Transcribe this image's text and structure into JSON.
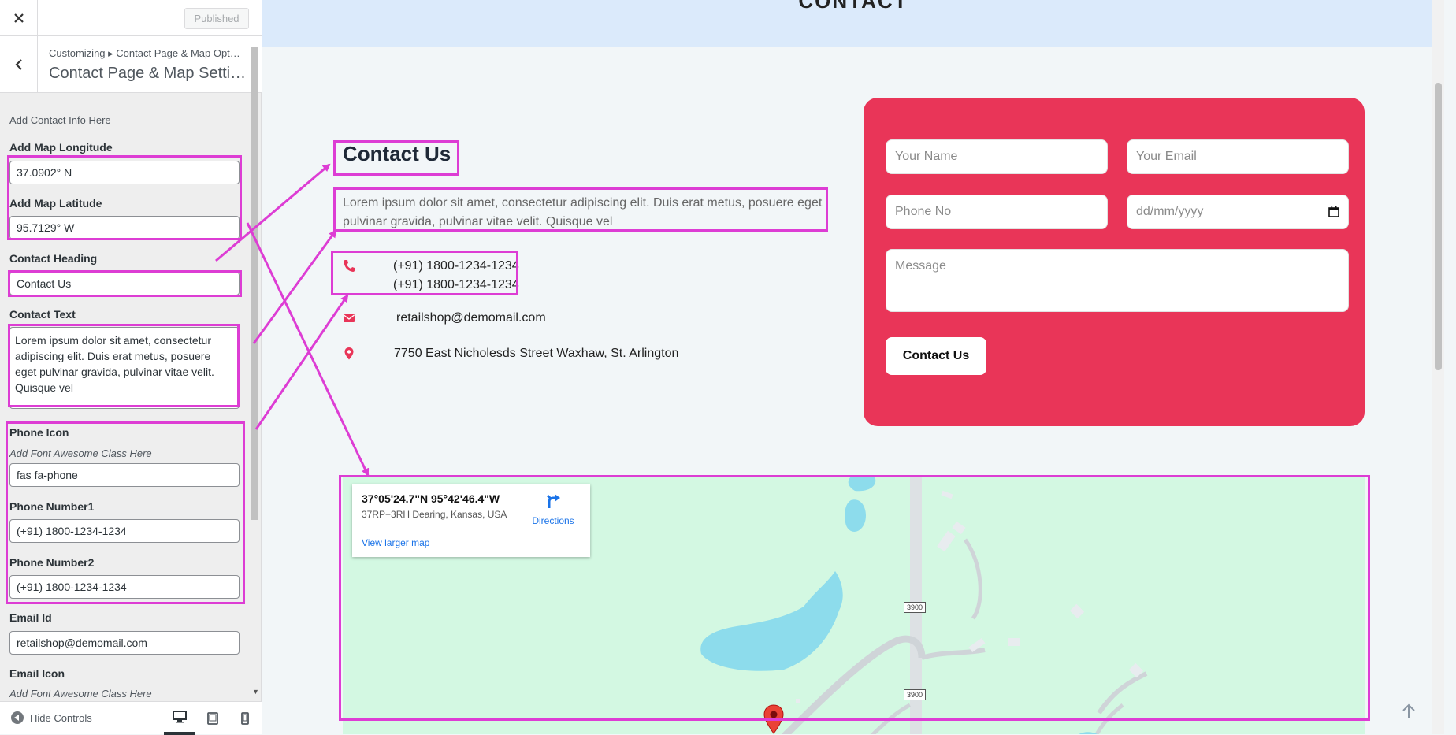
{
  "customizer": {
    "close_icon": "close-icon",
    "publish_label": "Published",
    "breadcrumb": "Customizing ▸ Contact Page & Map Opt…",
    "panel_title": "Contact Page & Map Setti…",
    "section_desc": "Add Contact Info Here",
    "fields": {
      "longitude_label": "Add Map Longitude",
      "longitude_value": "37.0902° N",
      "latitude_label": "Add Map Latitude",
      "latitude_value": "95.7129° W",
      "heading_label": "Contact Heading",
      "heading_value": "Contact Us",
      "text_label": "Contact Text",
      "text_value": "Lorem ipsum dolor sit amet, consectetur adipiscing elit. Duis erat metus, posuere eget pulvinar gravida, pulvinar vitae velit. Quisque vel",
      "phone_icon_label": "Phone Icon",
      "phone_icon_desc": "Add Font Awesome Class Here",
      "phone_icon_value": "fas fa-phone",
      "phone1_label": "Phone Number1",
      "phone1_value": "(+91) 1800-1234-1234",
      "phone2_label": "Phone Number2",
      "phone2_value": "(+91) 1800-1234-1234",
      "email_label": "Email Id",
      "email_value": "retailshop@demomail.com",
      "email_icon_label": "Email Icon",
      "email_icon_desc": "Add Font Awesome Class Here"
    },
    "footer": {
      "hide_controls": "Hide Controls",
      "devices": [
        "desktop",
        "tablet",
        "mobile"
      ]
    }
  },
  "preview": {
    "banner_title": "CONTACT",
    "contact_heading": "Contact Us",
    "contact_text": "Lorem ipsum dolor sit amet, consectetur adipiscing elit. Duis erat metus, posuere eget pulvinar gravida, pulvinar vitae velit. Quisque vel",
    "phone1": "(+91) 1800-1234-1234",
    "phone2": "(+91) 1800-1234-1234",
    "email": "retailshop@demomail.com",
    "address": "7750 East Nicholesds Street Waxhaw, St. Arlington",
    "form": {
      "name_placeholder": "Your Name",
      "email_placeholder": "Your Email",
      "phone_placeholder": "Phone No",
      "date_placeholder": "dd/mm/yyyy",
      "message_placeholder": "Message",
      "submit_label": "Contact Us"
    },
    "map": {
      "coords": "37°05'24.7\"N 95°42'46.4\"W",
      "plus_code": "37RP+3RH Dearing, Kansas, USA",
      "directions": "Directions",
      "larger_map": "View larger map",
      "road_label_1": "3900",
      "road_label_2": "3900"
    }
  },
  "colors": {
    "accent": "#e93558",
    "highlight": "#dd3dd4",
    "link": "#1a73e8",
    "map_land": "#d3f8e2",
    "map_water": "#8ddcec"
  }
}
